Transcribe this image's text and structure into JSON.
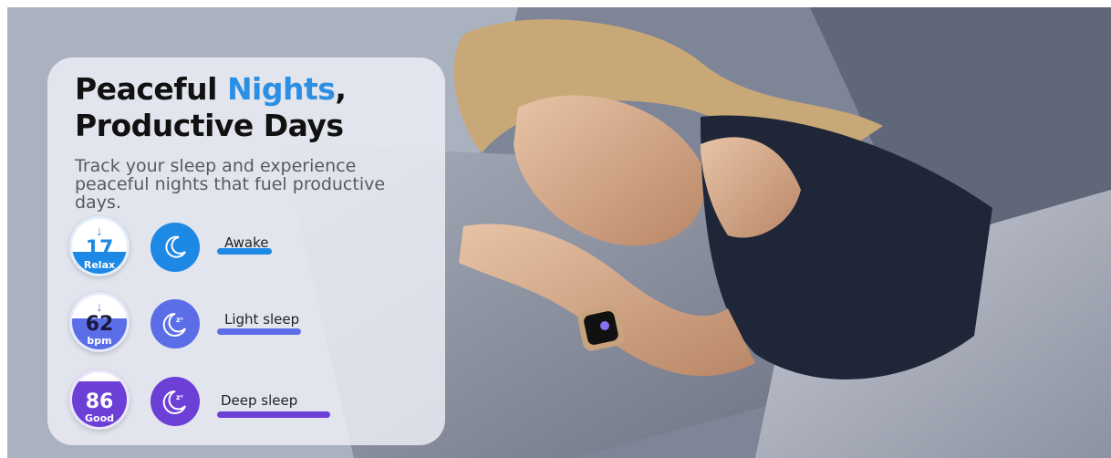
{
  "headline": {
    "line1_start": "Peaceful ",
    "line1_highlight": "Nights",
    "line1_end": ",",
    "line2": "Productive Days"
  },
  "subtitle": "Track your sleep and experience peaceful nights that fuel productive days.",
  "stages": [
    {
      "gauge_value": "17",
      "gauge_label": "Relax",
      "arrow": "down",
      "icon": "moon-icon",
      "label": "Awake",
      "color": "#1e88e5"
    },
    {
      "gauge_value": "62",
      "gauge_label": "bpm",
      "arrow": "down",
      "icon": "moon-zz-icon",
      "label": "Light sleep",
      "color": "#5b6ee8"
    },
    {
      "gauge_value": "86",
      "gauge_label": "Good",
      "arrow": "up",
      "icon": "moon-zz-icon",
      "label": "Deep sleep",
      "color": "#6c3fd6"
    }
  ],
  "colors": {
    "highlight": "#2b8fe3",
    "heading": "#111111"
  }
}
